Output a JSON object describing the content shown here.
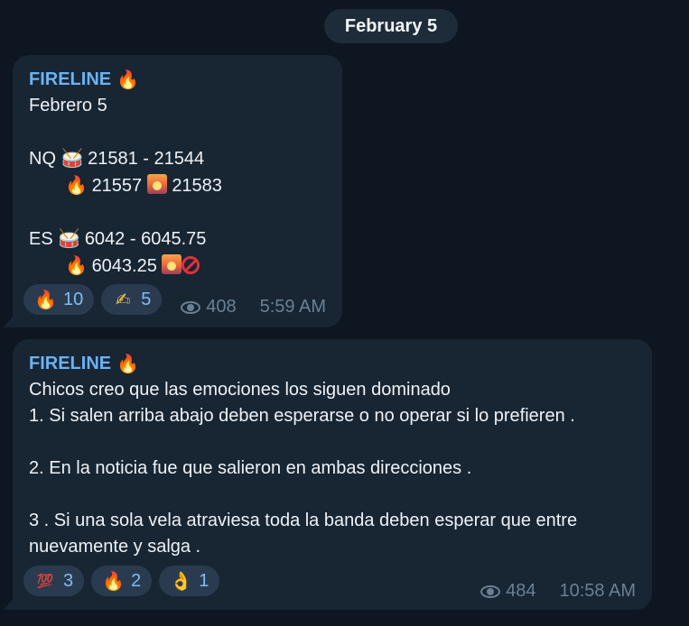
{
  "date_separator": "February 5",
  "messages": [
    {
      "sender": "FIRELINE",
      "lines": {
        "l1": "Febrero 5",
        "nq_label": "NQ",
        "nq_range": "21581 - 21544",
        "nq_fire": "21557",
        "nq_target": "21583",
        "es_label": "ES",
        "es_range": "6042 - 6045.75",
        "es_fire": "6043.25"
      },
      "reactions": [
        {
          "emoji": "fire-emoji",
          "count": "10"
        },
        {
          "emoji": "writing-hand-emoji",
          "count": "5"
        }
      ],
      "views": "408",
      "time": "5:59 AM"
    },
    {
      "sender": "FIRELINE",
      "text": "Chicos creo que las emociones los siguen dominado\n1. Si salen arriba abajo deben esperarse o no operar si lo prefieren .\n\n2. En la noticia fue que salieron en ambas direcciones .\n\n3 . Si una sola vela atraviesa toda la banda deben esperar que entre nuevamente y salga .",
      "reactions": [
        {
          "emoji": "hundred-points-emoji",
          "count": "3"
        },
        {
          "emoji": "fire-emoji",
          "count": "2"
        },
        {
          "emoji": "ok-hand-emoji",
          "count": "1"
        }
      ],
      "views": "484",
      "time": "10:58 AM"
    }
  ],
  "colors": {
    "background": "#0e1621",
    "bubble": "#182533",
    "sender": "#6ab3f3",
    "reaction_bg": "#2b3b4f",
    "reaction_count": "#7fbcf5",
    "meta": "#6b8094"
  }
}
